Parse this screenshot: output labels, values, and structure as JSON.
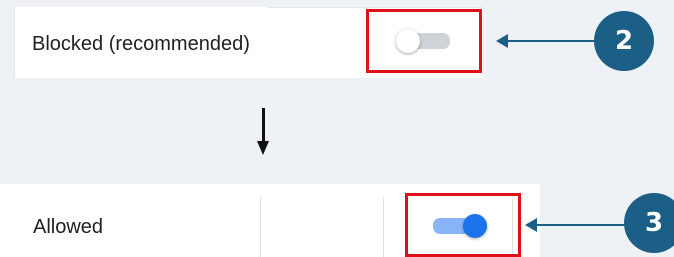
{
  "setting_before": {
    "label": "Blocked (recommended)",
    "toggle_state": "off",
    "callout_number": "2"
  },
  "setting_after": {
    "label": "Allowed",
    "toggle_state": "on",
    "callout_number": "3"
  },
  "colors": {
    "highlight": "#e0101a",
    "callout": "#1b5e86",
    "toggle_on_track": "#8ab4f8",
    "toggle_on_knob": "#1a73e8",
    "toggle_off_track": "#cfd3d8"
  },
  "icons": {
    "transition": "down-arrow-icon",
    "callout_pointer": "left-arrow-icon"
  }
}
